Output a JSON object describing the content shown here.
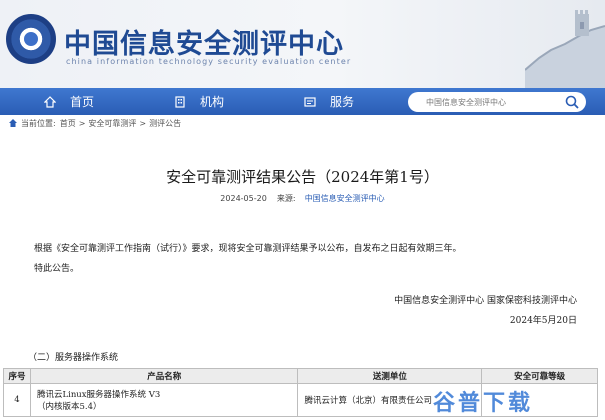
{
  "header": {
    "title": "中国信息安全测评中心",
    "subtitle": "china information technology security evaluation center",
    "brand_color": "#1f4a93"
  },
  "nav": {
    "items": [
      {
        "label": "首页",
        "icon": "home-icon"
      },
      {
        "label": "机构",
        "icon": "building-icon"
      },
      {
        "label": "服务",
        "icon": "service-icon"
      }
    ],
    "background": "#2f66bf"
  },
  "search": {
    "placeholder": "中国信息安全测评中心",
    "icon": "search-icon"
  },
  "breadcrumb": {
    "prefix": "当前位置:",
    "items": [
      "首页",
      "安全可靠测评",
      "测评公告"
    ],
    "separator": ">"
  },
  "article": {
    "title": "安全可靠测评结果公告（2024年第1号）",
    "date": "2024-05-20",
    "source_label": "来源:",
    "source_value": "中国信息安全测评中心",
    "paragraph1": "根据《安全可靠测评工作指南（试行）》要求，现将安全可靠测评结果予以公布，自发布之日起有效期三年。",
    "paragraph2": "特此公告。",
    "signatories": "中国信息安全测评中心  国家保密科技测评中心",
    "sign_date": "2024年5月20日"
  },
  "section": {
    "heading": "（二）服务器操作系统"
  },
  "table": {
    "headers": [
      "序号",
      "产品名称",
      "送测单位",
      "安全可靠等级"
    ],
    "rows": [
      {
        "no": "4",
        "product_line1": "腾讯云Linux服务器操作系统 V3",
        "product_line2": "（内核版本5.4）",
        "unit": "腾讯云计算（北京）有限责任公司",
        "grade": ""
      }
    ]
  },
  "watermark": {
    "text": "谷普下载"
  }
}
